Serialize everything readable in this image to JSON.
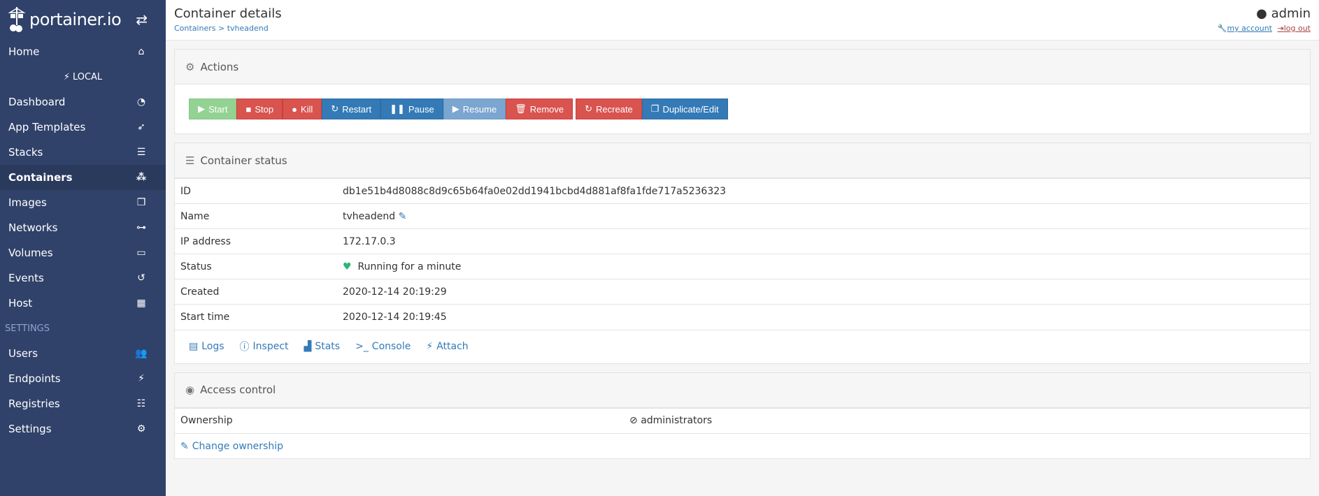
{
  "brand": {
    "name": "portainer.io"
  },
  "sidebar": {
    "home": "Home",
    "endpoint": "LOCAL",
    "items": [
      {
        "label": "Dashboard"
      },
      {
        "label": "App Templates"
      },
      {
        "label": "Stacks"
      },
      {
        "label": "Containers"
      },
      {
        "label": "Images"
      },
      {
        "label": "Networks"
      },
      {
        "label": "Volumes"
      },
      {
        "label": "Events"
      },
      {
        "label": "Host"
      }
    ],
    "settings_header": "SETTINGS",
    "settings_items": [
      {
        "label": "Users"
      },
      {
        "label": "Endpoints"
      },
      {
        "label": "Registries"
      },
      {
        "label": "Settings"
      }
    ]
  },
  "header": {
    "title": "Container details",
    "breadcrumb": {
      "parent": "Containers",
      "separator": " > ",
      "current": "tvheadend"
    },
    "user": "admin",
    "my_account": "my account",
    "log_out": "log out"
  },
  "actions": {
    "title": "Actions",
    "buttons": {
      "start": "Start",
      "stop": "Stop",
      "kill": "Kill",
      "restart": "Restart",
      "pause": "Pause",
      "resume": "Resume",
      "remove": "Remove",
      "recreate": "Recreate",
      "duplicate": "Duplicate/Edit"
    }
  },
  "status": {
    "title": "Container status",
    "rows": {
      "id": {
        "label": "ID",
        "value": "db1e51b4d8088c8d9c65b64fa0e02dd1941bcbd4d881af8fa1fde717a5236323"
      },
      "name": {
        "label": "Name",
        "value": "tvheadend"
      },
      "ip": {
        "label": "IP address",
        "value": "172.17.0.3"
      },
      "status": {
        "label": "Status",
        "value": "Running for a minute"
      },
      "created": {
        "label": "Created",
        "value": "2020-12-14 20:19:29"
      },
      "start": {
        "label": "Start time",
        "value": "2020-12-14 20:19:45"
      }
    },
    "links": {
      "logs": "Logs",
      "inspect": "Inspect",
      "stats": "Stats",
      "console": "Console",
      "attach": "Attach"
    }
  },
  "access": {
    "title": "Access control",
    "ownership_label": "Ownership",
    "ownership_value": "administrators",
    "change": "Change ownership"
  }
}
